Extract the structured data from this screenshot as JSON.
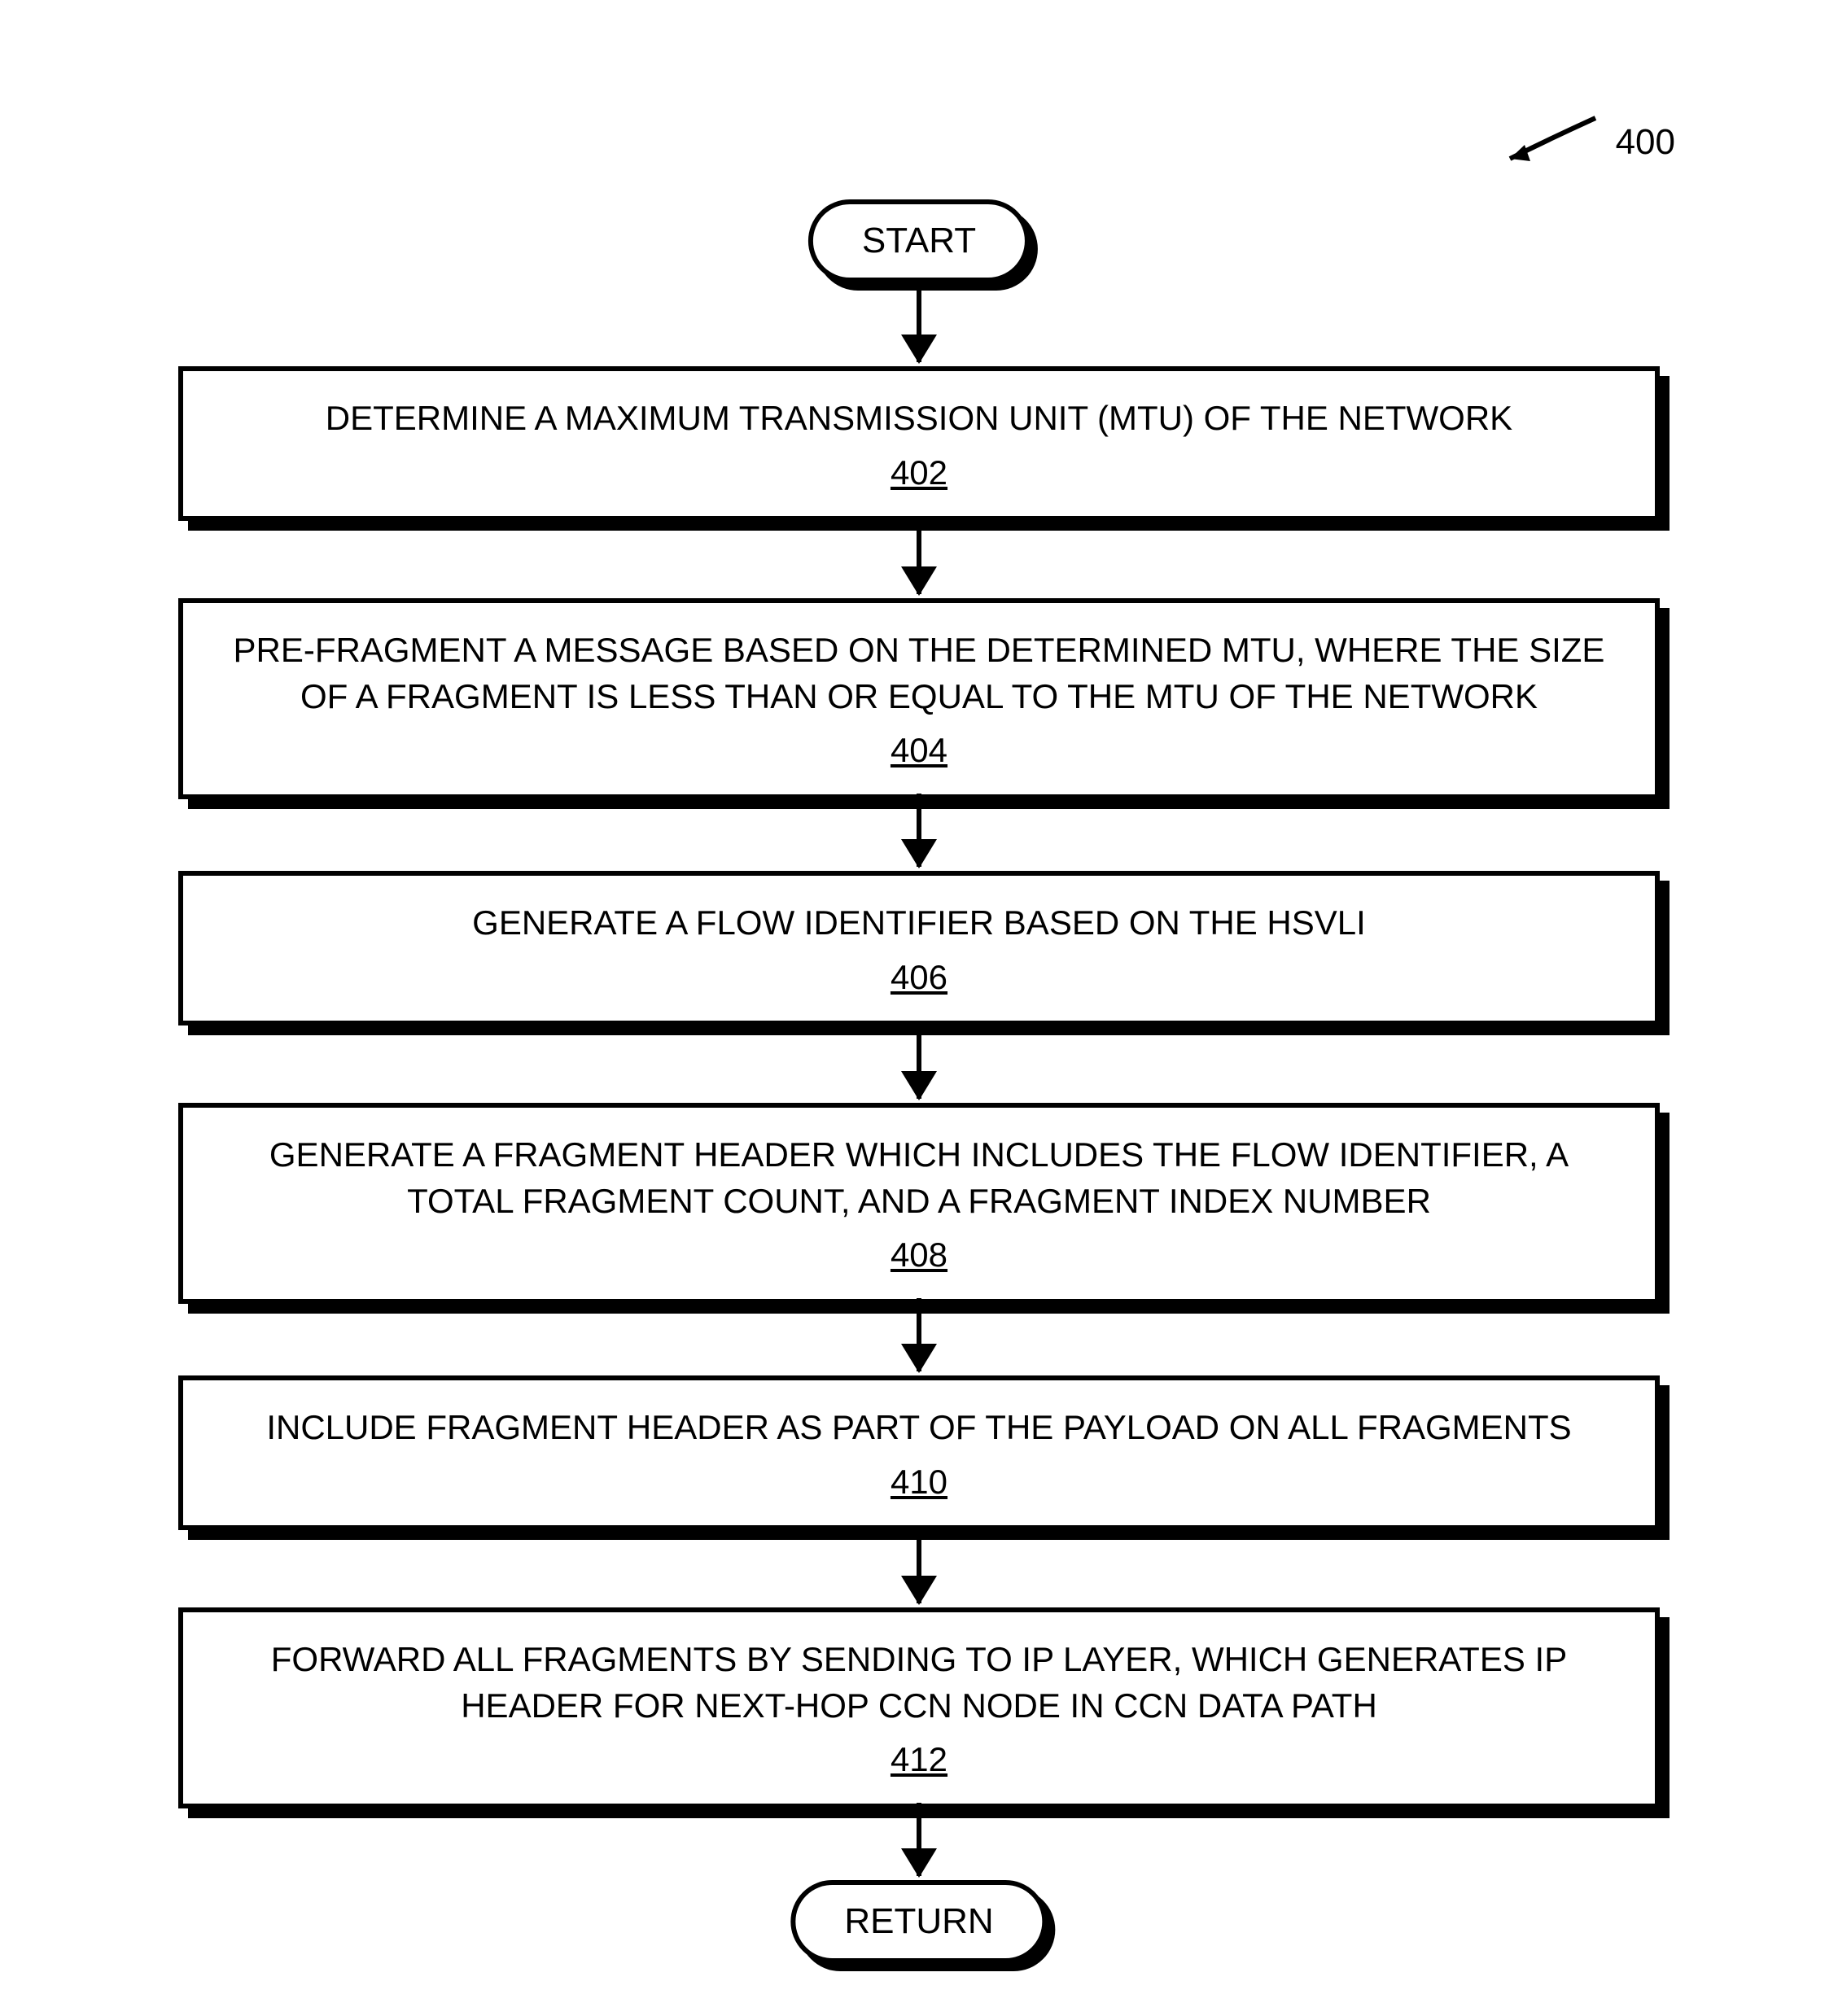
{
  "figure_label": "400",
  "start_label": "START",
  "return_label": "RETURN",
  "steps": [
    {
      "text": "DETERMINE A MAXIMUM TRANSMISSION UNIT (MTU) OF THE NETWORK",
      "ref": "402"
    },
    {
      "text": "PRE-FRAGMENT A MESSAGE BASED ON THE DETERMINED MTU, WHERE THE SIZE OF A FRAGMENT IS LESS THAN OR EQUAL TO THE MTU OF THE NETWORK",
      "ref": "404"
    },
    {
      "text": "GENERATE A FLOW IDENTIFIER BASED ON THE HSVLI",
      "ref": "406"
    },
    {
      "text": "GENERATE A FRAGMENT HEADER WHICH INCLUDES THE FLOW IDENTIFIER, A TOTAL FRAGMENT COUNT, AND A FRAGMENT INDEX NUMBER",
      "ref": "408"
    },
    {
      "text": "INCLUDE FRAGMENT HEADER AS PART OF THE PAYLOAD ON ALL FRAGMENTS",
      "ref": "410"
    },
    {
      "text": "FORWARD ALL FRAGMENTS BY SENDING TO IP LAYER, WHICH GENERATES IP HEADER FOR NEXT-HOP CCN NODE IN CCN DATA PATH",
      "ref": "412"
    }
  ]
}
